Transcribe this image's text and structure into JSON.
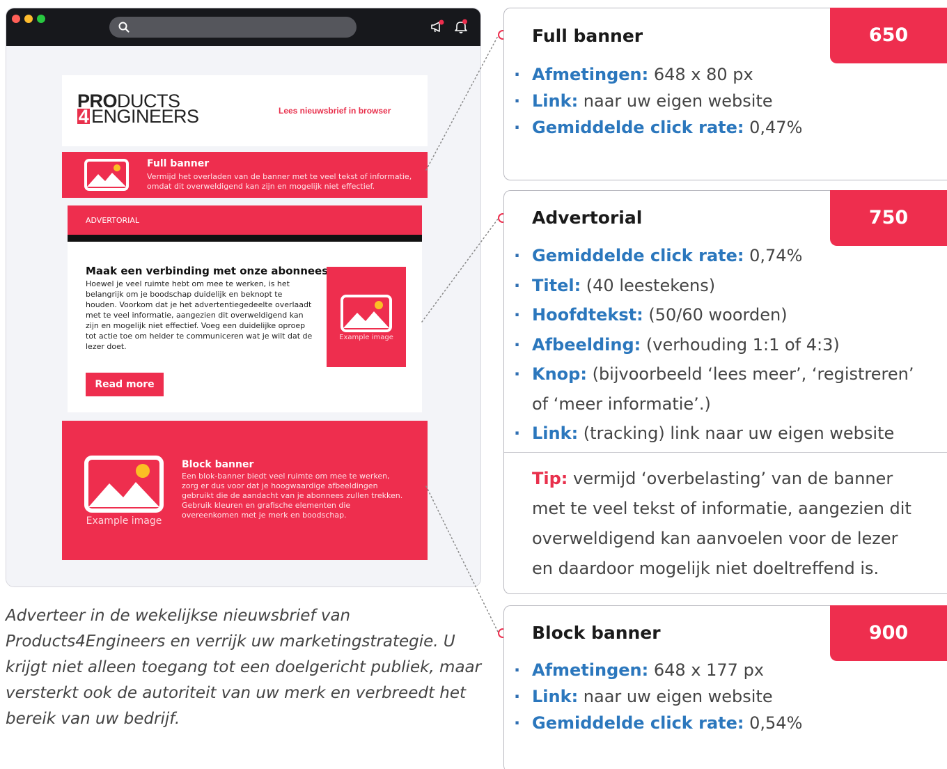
{
  "browser": {
    "search_placeholder": ""
  },
  "newsletter": {
    "logo_line1_bold": "PRO",
    "logo_line1_thin": "DUCTS",
    "logo_line2_four": "4",
    "logo_line2_thin": "ENGINEERS",
    "view_in_browser": "Lees nieuwsbrief in browser",
    "full_banner": {
      "title": "Full banner",
      "text": "Vermijd het overladen van de banner met te veel tekst of informatie, omdat dit overweldigend kan zijn en mogelijk niet effectief."
    },
    "advertorial": {
      "label": "ADVERTORIAL",
      "title": "Maak een verbinding met onze abonnees",
      "text": "Hoewel je veel ruimte hebt om mee te werken, is het belangrijk om je boodschap duidelijk en beknopt te houden. Voorkom dat je het advertentiegedeelte overlaadt met te veel informatie, aangezien dit overweldigend kan zijn en mogelijk niet effectief. Voeg een duidelijke oproep tot actie toe om helder te communiceren wat je wilt dat de lezer doet.",
      "image_caption": "Example image",
      "button": "Read more"
    },
    "block_banner": {
      "title": "Block banner",
      "text": "Een blok-banner biedt veel ruimte om mee te werken, zorg er dus voor dat je hoogwaardige afbeeldingen gebruikt die de aandacht van je abonnees zullen trekken. Gebruik kleuren en grafische elementen die overeenkomen met je merk en boodschap.",
      "image_caption": "Example image"
    }
  },
  "intro": "Adverteer in de wekelijkse nieuwsbrief van Products4Engineers en verrijk uw marketingstrategie. U krijgt niet alleen toegang tot een doelgericht publiek, maar versterkt ook de autoriteit van uw merk en verbreedt het bereik van uw bedrijf.",
  "cards": {
    "full": {
      "title": "Full banner",
      "price": "650",
      "items": [
        {
          "label": "Afmetingen:",
          "value": " 648 x 80 px"
        },
        {
          "label": "Link:",
          "value": " naar uw eigen website"
        },
        {
          "label": "Gemiddelde click rate:",
          "value": " 0,47%"
        }
      ]
    },
    "advertorial": {
      "title": "Advertorial",
      "price": "750",
      "items": [
        {
          "label": "Gemiddelde click rate:",
          "value": " 0,74%"
        },
        {
          "label": "Titel:",
          "value": " (40 leestekens)"
        },
        {
          "label": "Hoofdtekst:",
          "value": " (50/60 woorden)"
        },
        {
          "label": "Afbeelding:",
          "value": " (verhouding 1:1 of 4:3)"
        },
        {
          "label": "Knop:",
          "value": "  (bijvoorbeeld ‘lees meer’, ‘registreren’"
        },
        {
          "label": "Link:",
          "value": " (tracking) link naar uw eigen website"
        }
      ],
      "knop_continuation": "of ‘meer informatie’.)",
      "tip_label": "Tip:",
      "tip_text": " vermijd ‘overbelasting’ van de banner met te veel tekst of informatie, aangezien dit overweldigend kan aanvoelen voor de lezer en daardoor mogelijk niet doeltreffend is."
    },
    "block": {
      "title": "Block banner",
      "price": "900",
      "items": [
        {
          "label": "Afmetingen:",
          "value": " 648 x 177 px"
        },
        {
          "label": "Link:",
          "value": " naar uw eigen website"
        },
        {
          "label": "Gemiddelde click rate:",
          "value": " 0,54%"
        }
      ]
    }
  },
  "colors": {
    "accent": "#ee2e4e",
    "label_blue": "#2b77bd",
    "titlebar": "#17181c"
  },
  "icons": [
    "search-icon",
    "megaphone-icon",
    "bell-icon",
    "image-placeholder-icon"
  ]
}
